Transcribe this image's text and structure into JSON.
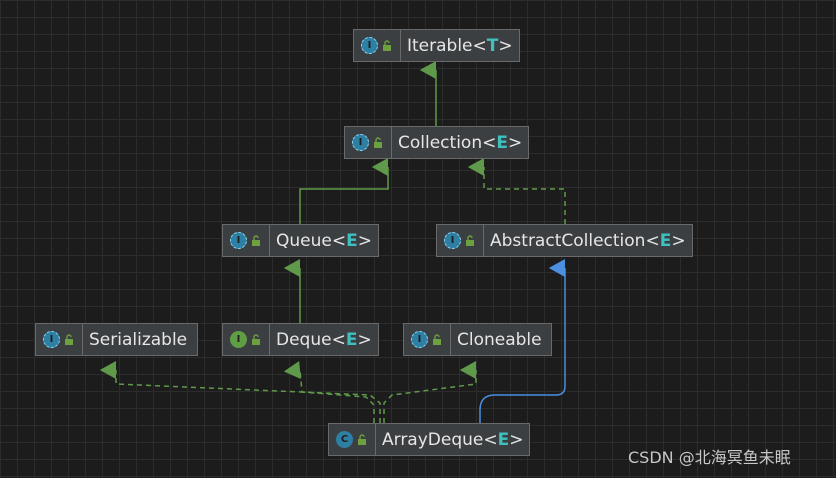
{
  "nodes": {
    "iterable": {
      "name": "Iterable",
      "param": "T",
      "kind": "abstract"
    },
    "collection": {
      "name": "Collection",
      "param": "E",
      "kind": "abstract"
    },
    "queue": {
      "name": "Queue",
      "param": "E",
      "kind": "abstract"
    },
    "abstract_collection": {
      "name": "AbstractCollection",
      "param": "E",
      "kind": "abstract"
    },
    "serializable": {
      "name": "Serializable",
      "param": "",
      "kind": "abstract"
    },
    "deque": {
      "name": "Deque",
      "param": "E",
      "kind": "interface"
    },
    "cloneable": {
      "name": "Cloneable",
      "param": "",
      "kind": "abstract"
    },
    "array_deque": {
      "name": "ArrayDeque",
      "param": "E",
      "kind": "class"
    }
  },
  "icons": {
    "abstract_letter": "I",
    "interface_letter": "I",
    "class_letter": "C"
  },
  "colors": {
    "extends_edge": "#5e9a4a",
    "implements_edge": "#5e9a4a",
    "class_extends_edge": "#4a8fe0",
    "type_param": "#3fc0c0"
  },
  "watermark": "CSDN @北海冥鱼未眠"
}
